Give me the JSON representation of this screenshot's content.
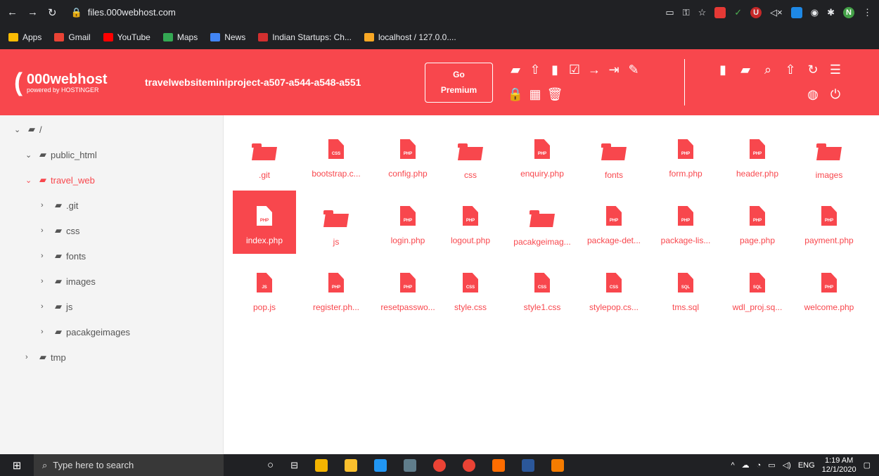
{
  "browser": {
    "url": "files.000webhost.com",
    "bookmarks": [
      "Apps",
      "Gmail",
      "YouTube",
      "Maps",
      "News",
      "Indian Startups: Ch...",
      "localhost / 127.0.0...."
    ],
    "profile_initial": "N"
  },
  "header": {
    "logo_main": "000webhost",
    "logo_sub": "powered by HOSTINGER",
    "project": "travelwebsiteminiproject-a507-a544-a548-a551",
    "premium_line1": "Go",
    "premium_line2": "Premium",
    "tool_icons": [
      "folder-open-icon",
      "upload-icon",
      "new-file-icon",
      "edit-icon",
      "move-icon",
      "sign-out-icon",
      "pencil-icon",
      "lock-icon",
      "archive-icon",
      "trash-icon"
    ],
    "right_icons": [
      "new-file-plus-icon",
      "upload-folder-icon",
      "search-icon",
      "cloud-upload-icon",
      "refresh-icon",
      "list-view-icon",
      "globe-icon",
      "power-icon"
    ]
  },
  "tree": [
    {
      "label": "/",
      "level": 0,
      "expanded": true
    },
    {
      "label": "public_html",
      "level": 1,
      "expanded": true
    },
    {
      "label": "travel_web",
      "level": 2,
      "expanded": true,
      "active": true
    },
    {
      "label": ".git",
      "level": 3
    },
    {
      "label": "css",
      "level": 3
    },
    {
      "label": "fonts",
      "level": 3
    },
    {
      "label": "images",
      "level": 3
    },
    {
      "label": "js",
      "level": 3
    },
    {
      "label": "pacakgeimages",
      "level": 3
    },
    {
      "label": "tmp",
      "level": 1
    }
  ],
  "files": [
    {
      "name": ".git",
      "type": "folder"
    },
    {
      "name": "bootstrap.c...",
      "type": "CSS"
    },
    {
      "name": "config.php",
      "type": "PHP"
    },
    {
      "name": "css",
      "type": "folder"
    },
    {
      "name": "enquiry.php",
      "type": "PHP"
    },
    {
      "name": "fonts",
      "type": "folder"
    },
    {
      "name": "form.php",
      "type": "PHP"
    },
    {
      "name": "header.php",
      "type": "PHP"
    },
    {
      "name": "images",
      "type": "folder"
    },
    {
      "name": "index.php",
      "type": "PHP",
      "selected": true
    },
    {
      "name": "js",
      "type": "folder"
    },
    {
      "name": "login.php",
      "type": "PHP"
    },
    {
      "name": "logout.php",
      "type": "PHP"
    },
    {
      "name": "pacakgeimag...",
      "type": "folder"
    },
    {
      "name": "package-det...",
      "type": "PHP"
    },
    {
      "name": "package-lis...",
      "type": "PHP"
    },
    {
      "name": "page.php",
      "type": "PHP"
    },
    {
      "name": "payment.php",
      "type": "PHP"
    },
    {
      "name": "pop.js",
      "type": "JS"
    },
    {
      "name": "register.ph...",
      "type": "PHP"
    },
    {
      "name": "resetpasswo...",
      "type": "PHP"
    },
    {
      "name": "style.css",
      "type": "CSS"
    },
    {
      "name": "style1.css",
      "type": "CSS"
    },
    {
      "name": "stylepop.cs...",
      "type": "CSS"
    },
    {
      "name": "tms.sql",
      "type": "SQL"
    },
    {
      "name": "wdl_proj.sq...",
      "type": "SQL"
    },
    {
      "name": "welcome.php",
      "type": "PHP"
    }
  ],
  "taskbar": {
    "search_placeholder": "Type here to search",
    "lang": "ENG",
    "time": "1:19 AM",
    "date": "12/1/2020"
  },
  "colors": {
    "accent": "#f8474d",
    "chrome": "#202124"
  }
}
